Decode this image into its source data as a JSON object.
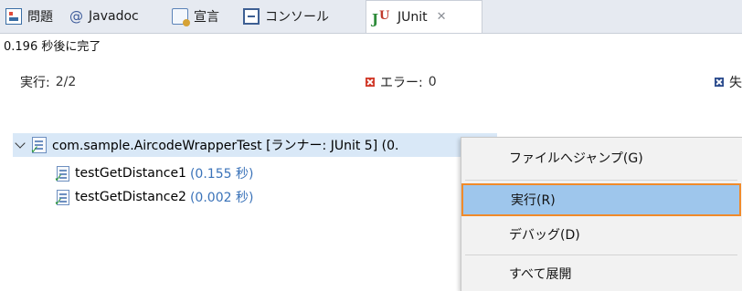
{
  "tabs": [
    {
      "label": "問題",
      "icon": "problems-icon"
    },
    {
      "label": "Javadoc",
      "icon": "at-icon"
    },
    {
      "label": "宣言",
      "icon": "declaration-icon"
    },
    {
      "label": "コンソール",
      "icon": "console-icon"
    },
    {
      "label": "JUnit",
      "icon": "junit-icon",
      "active": true
    }
  ],
  "status": {
    "elapsed": "0.196 秒後に完了"
  },
  "counters": {
    "runs_label": "実行:",
    "runs_value": "2/2",
    "errors_label": "エラー:",
    "errors_value": "0",
    "failures_label": "失"
  },
  "tree": {
    "root": "com.sample.AircodeWrapperTest [ランナー: JUnit 5] (0.",
    "tests": [
      {
        "name": "testGetDistance1",
        "time": "(0.155 秒)"
      },
      {
        "name": "testGetDistance2",
        "time": "(0.002 秒)"
      }
    ]
  },
  "context_menu": {
    "items": [
      {
        "label": "ファイルへジャンプ(G)"
      },
      {
        "label": "実行(R)",
        "highlighted": true
      },
      {
        "label": "デバッグ(D)"
      },
      {
        "label": "すべて展開"
      }
    ]
  },
  "colors": {
    "selection": "#d9e8f7",
    "menu_highlight": "#9ec6ec",
    "highlight_border": "#f08a2a",
    "time_text": "#3b73b9"
  }
}
